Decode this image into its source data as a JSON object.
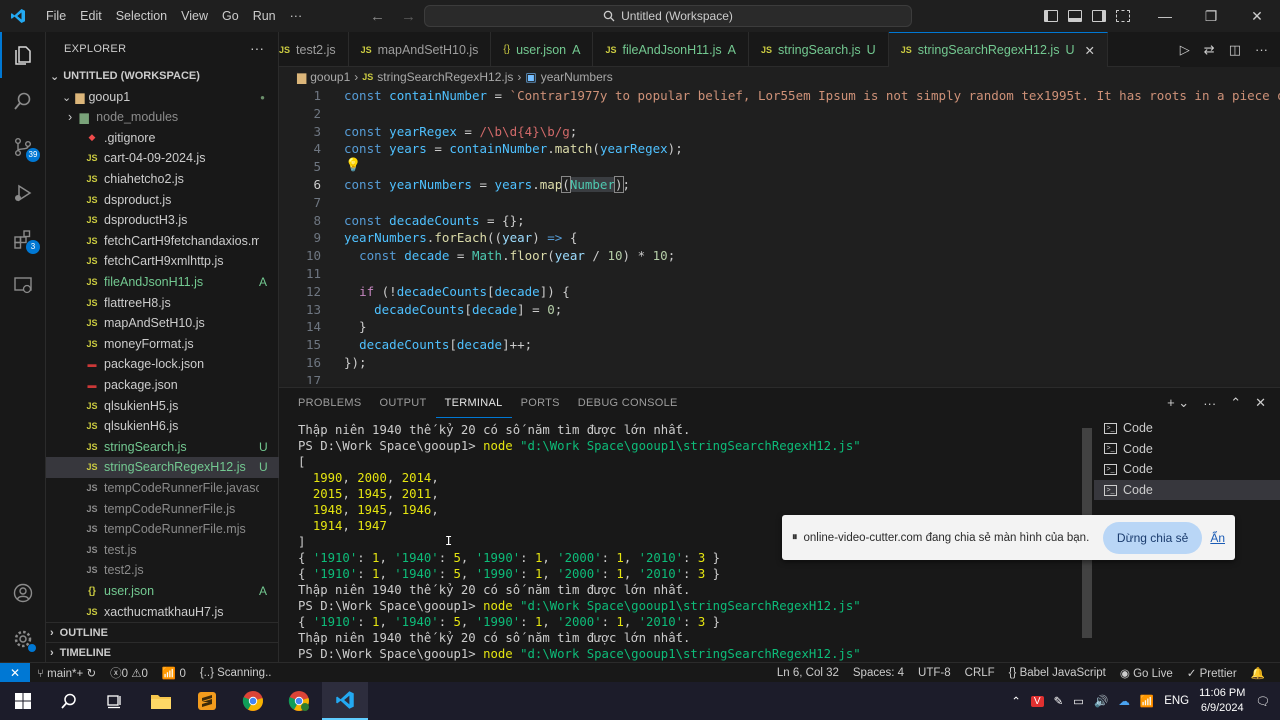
{
  "titlebar": {
    "menu": [
      "File",
      "Edit",
      "Selection",
      "View",
      "Go",
      "Run",
      "···"
    ],
    "search_text": "Untitled (Workspace)"
  },
  "activity": {
    "scm_badge": "39",
    "ext_badge": "3"
  },
  "sidebar": {
    "title": "EXPLORER",
    "workspace": "UNTITLED (WORKSPACE)",
    "folder": "gooup1",
    "files": [
      {
        "name": "node_modules",
        "type": "folder",
        "status": ""
      },
      {
        "name": ".gitignore",
        "type": "git",
        "status": ""
      },
      {
        "name": "cart-04-09-2024.js",
        "type": "js",
        "status": ""
      },
      {
        "name": "chiahetcho2.js",
        "type": "js",
        "status": ""
      },
      {
        "name": "dsproduct.js",
        "type": "js",
        "status": ""
      },
      {
        "name": "dsproductH3.js",
        "type": "js",
        "status": ""
      },
      {
        "name": "fetchCartH9fetchandaxios.mjs",
        "type": "js",
        "status": ""
      },
      {
        "name": "fetchCartH9xmlhttp.js",
        "type": "js",
        "status": ""
      },
      {
        "name": "fileAndJsonH11.js",
        "type": "js",
        "status": "A"
      },
      {
        "name": "flattreeH8.js",
        "type": "js",
        "status": ""
      },
      {
        "name": "mapAndSetH10.js",
        "type": "js",
        "status": ""
      },
      {
        "name": "moneyFormat.js",
        "type": "js",
        "status": ""
      },
      {
        "name": "package-lock.json",
        "type": "npm",
        "status": ""
      },
      {
        "name": "package.json",
        "type": "npm",
        "status": ""
      },
      {
        "name": "qlsukienH5.js",
        "type": "js",
        "status": ""
      },
      {
        "name": "qlsukienH6.js",
        "type": "js",
        "status": ""
      },
      {
        "name": "stringSearch.js",
        "type": "js",
        "status": "U"
      },
      {
        "name": "stringSearchRegexH12.js",
        "type": "js",
        "status": "U"
      },
      {
        "name": "tempCodeRunnerFile.javascript",
        "type": "tmp",
        "status": ""
      },
      {
        "name": "tempCodeRunnerFile.js",
        "type": "tmp",
        "status": ""
      },
      {
        "name": "tempCodeRunnerFile.mjs",
        "type": "tmp",
        "status": ""
      },
      {
        "name": "test.js",
        "type": "tmp",
        "status": ""
      },
      {
        "name": "test2.js",
        "type": "tmp",
        "status": ""
      },
      {
        "name": "user.json",
        "type": "json",
        "status": "A"
      },
      {
        "name": "xacthucmatkhauH7.js",
        "type": "js",
        "status": ""
      }
    ],
    "outline": "OUTLINE",
    "timeline": "TIMELINE"
  },
  "tabs": [
    {
      "name": "test2.js",
      "icon": "JS",
      "status": ""
    },
    {
      "name": "mapAndSetH10.js",
      "icon": "JS",
      "status": ""
    },
    {
      "name": "user.json",
      "icon": "{}",
      "status": "A"
    },
    {
      "name": "fileAndJsonH11.js",
      "icon": "JS",
      "status": "A"
    },
    {
      "name": "stringSearch.js",
      "icon": "JS",
      "status": "U"
    },
    {
      "name": "stringSearchRegexH12.js",
      "icon": "JS",
      "status": "U"
    }
  ],
  "breadcrumb": [
    "gooup1",
    "stringSearchRegexH12.js",
    "yearNumbers"
  ],
  "editor": {
    "line_numbers": [
      "1",
      "2",
      "3",
      "4",
      "5",
      "6",
      "7",
      "8",
      "9",
      "10",
      "11",
      "12",
      "13",
      "14",
      "15",
      "16",
      "17"
    ],
    "line1_string": "`Contrar1977y to popular belief, Lor55em Ipsum is not simply random tex1995t. It has roots in a piece o"
  },
  "panel": {
    "tabs": [
      "PROBLEMS",
      "OUTPUT",
      "TERMINAL",
      "PORTS",
      "DEBUG CONSOLE"
    ],
    "terminal_lines": [
      "Thập niên 1940 thế kỷ 20 có số năm tìm được lớn nhất.",
      "PS D:\\Work Space\\gooup1> ",
      "[",
      "  1990, 2000, 2014,",
      "  2015, 1945, 2011,",
      "  1948, 1945, 1946,",
      "  1914, 1947",
      "]",
      "{ '1910': 1, '1940': 5, '1990': 1, '2000': 1, '2010': 3 }",
      "{ '1910': 1, '1940': 5, '1990': 1, '2000': 1, '2010': 3 }",
      "Thập niên 1940 thế kỷ 20 có số năm tìm được lớn nhất.",
      "PS D:\\Work Space\\gooup1> ",
      "{ '1910': 1, '1940': 5, '1990': 1, '2000': 1, '2010': 3 }",
      "Thập niên 1940 thế kỷ 20 có số năm tìm được lớn nhất.",
      "PS D:\\Work Space\\gooup1> "
    ],
    "node_cmd": "node",
    "node_path": "\"d:\\Work Space\\gooup1\\stringSearchRegexH12.js\"",
    "terminal_list": [
      "Code",
      "Code",
      "Code",
      "Code"
    ]
  },
  "share": {
    "message": "online-video-cutter.com đang chia sẻ màn hình của bạn.",
    "stop_label": "Dừng chia sẻ",
    "hide_label": "Ẩn"
  },
  "statusbar": {
    "branch": "main*+",
    "errors": "0",
    "warnings": "0",
    "ports": "0",
    "scanning": "{..} Scanning..",
    "position": "Ln 6, Col 32",
    "spaces": "Spaces: 4",
    "encoding": "UTF-8",
    "eol": "CRLF",
    "language": "Babel JavaScript",
    "golive": "Go Live",
    "prettier": "Prettier"
  },
  "taskbar": {
    "lang": "ENG",
    "time": "11:06 PM",
    "date": "6/9/2024"
  }
}
